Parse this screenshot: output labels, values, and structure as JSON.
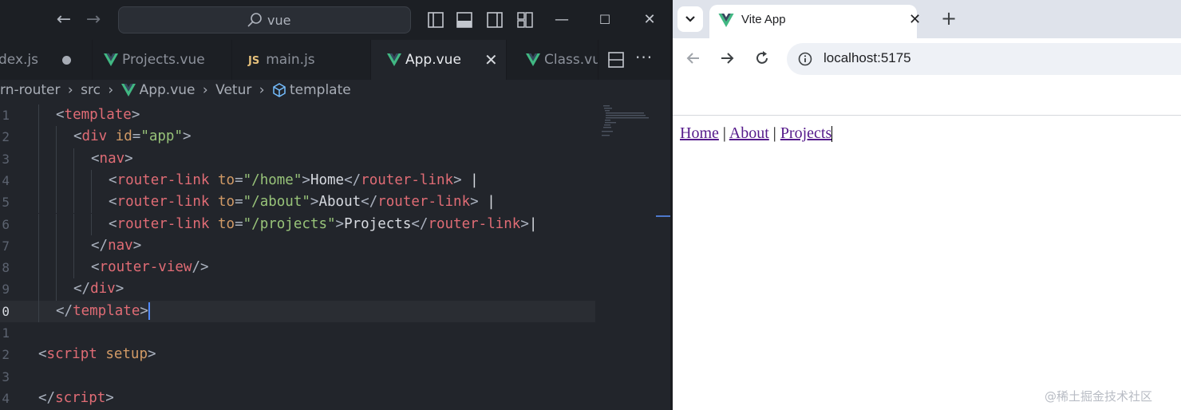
{
  "vscode": {
    "search_text": "vue",
    "tabs": [
      {
        "label": "dex.js",
        "dirty": true
      },
      {
        "label": "Projects.vue"
      },
      {
        "label": "main.js",
        "badge": "JS"
      },
      {
        "label": "App.vue",
        "active": true
      },
      {
        "label": "Class.vue"
      }
    ],
    "breadcrumb": {
      "folder": "rn-router",
      "sub": "src",
      "file": "App.vue",
      "ext": "Vetur",
      "symbol": "template"
    },
    "line_numbers": [
      "1",
      "2",
      "3",
      "4",
      "5",
      "6",
      "7",
      "8",
      "9",
      "0",
      "1",
      "2",
      "3",
      "4"
    ],
    "current_line_index": 9,
    "code_lines": [
      {
        "indent": 1,
        "tokens": [
          [
            "p",
            "<"
          ],
          [
            "tag",
            "template"
          ],
          [
            "p",
            ">"
          ]
        ]
      },
      {
        "indent": 2,
        "tokens": [
          [
            "p",
            "<"
          ],
          [
            "tag",
            "div"
          ],
          [
            "txt",
            " "
          ],
          [
            "attr",
            "id"
          ],
          [
            "p",
            "="
          ],
          [
            "str",
            "\"app\""
          ],
          [
            "p",
            ">"
          ]
        ]
      },
      {
        "indent": 3,
        "tokens": [
          [
            "p",
            "<"
          ],
          [
            "tag",
            "nav"
          ],
          [
            "p",
            ">"
          ]
        ]
      },
      {
        "indent": 4,
        "tokens": [
          [
            "p",
            "<"
          ],
          [
            "tag",
            "router-link"
          ],
          [
            "txt",
            " "
          ],
          [
            "attr",
            "to"
          ],
          [
            "p",
            "="
          ],
          [
            "str",
            "\"/home\""
          ],
          [
            "p",
            ">"
          ],
          [
            "txt",
            "Home"
          ],
          [
            "p",
            "</"
          ],
          [
            "tag",
            "router-link"
          ],
          [
            "p",
            ">"
          ],
          [
            "txt",
            " |"
          ]
        ]
      },
      {
        "indent": 4,
        "tokens": [
          [
            "p",
            "<"
          ],
          [
            "tag",
            "router-link"
          ],
          [
            "txt",
            " "
          ],
          [
            "attr",
            "to"
          ],
          [
            "p",
            "="
          ],
          [
            "str",
            "\"/about\""
          ],
          [
            "p",
            ">"
          ],
          [
            "txt",
            "About"
          ],
          [
            "p",
            "</"
          ],
          [
            "tag",
            "router-link"
          ],
          [
            "p",
            ">"
          ],
          [
            "txt",
            " |"
          ]
        ]
      },
      {
        "indent": 4,
        "tokens": [
          [
            "p",
            "<"
          ],
          [
            "tag",
            "router-link"
          ],
          [
            "txt",
            " "
          ],
          [
            "attr",
            "to"
          ],
          [
            "p",
            "="
          ],
          [
            "str",
            "\"/projects\""
          ],
          [
            "p",
            ">"
          ],
          [
            "txt",
            "Projects"
          ],
          [
            "p",
            "</"
          ],
          [
            "tag",
            "router-link"
          ],
          [
            "p",
            ">"
          ],
          [
            "txt",
            "|"
          ]
        ]
      },
      {
        "indent": 3,
        "tokens": [
          [
            "p",
            "</"
          ],
          [
            "tag",
            "nav"
          ],
          [
            "p",
            ">"
          ]
        ]
      },
      {
        "indent": 3,
        "tokens": [
          [
            "p",
            "<"
          ],
          [
            "tag",
            "router-view"
          ],
          [
            "p",
            "/>"
          ]
        ]
      },
      {
        "indent": 2,
        "tokens": [
          [
            "p",
            "</"
          ],
          [
            "tag",
            "div"
          ],
          [
            "p",
            ">"
          ]
        ]
      },
      {
        "indent": 1,
        "tokens": [
          [
            "p",
            "</"
          ],
          [
            "tag",
            "template"
          ],
          [
            "p",
            ">"
          ]
        ],
        "cursor": true
      },
      {
        "indent": 0,
        "tokens": []
      },
      {
        "indent": 0,
        "tokens": [
          [
            "p",
            "<"
          ],
          [
            "tag",
            "script"
          ],
          [
            "txt",
            " "
          ],
          [
            "attr",
            "setup"
          ],
          [
            "p",
            ">"
          ]
        ]
      },
      {
        "indent": 0,
        "tokens": []
      },
      {
        "indent": 0,
        "tokens": [
          [
            "p",
            "</"
          ],
          [
            "tag",
            "script"
          ],
          [
            "p",
            ">"
          ]
        ]
      }
    ]
  },
  "browser": {
    "tab_title": "Vite App",
    "url": "localhost:5175",
    "nav_links": [
      "Home",
      "About",
      "Projects"
    ],
    "separator": " | ",
    "watermark": "@稀土掘金技术社区"
  },
  "colors": {
    "editor_bg": "#22252b",
    "tag": "#e06c75",
    "attribute": "#d19a66",
    "string": "#98c379",
    "vue_green": "#41b883",
    "link_visited": "#551a8b"
  }
}
